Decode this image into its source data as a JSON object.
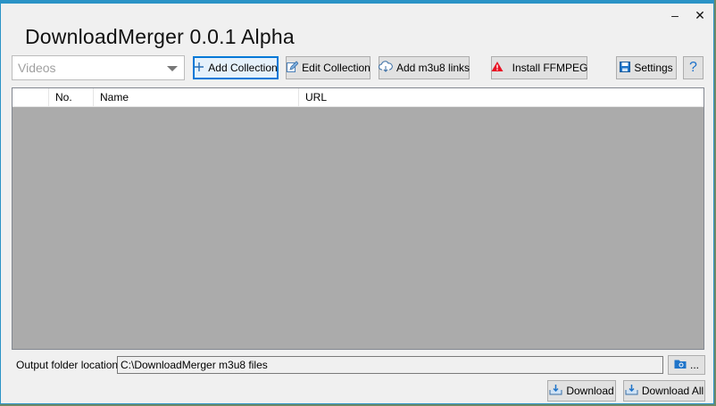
{
  "window": {
    "title": "DownloadMerger 0.0.1 Alpha",
    "minimize_glyph": "–",
    "close_glyph": "✕"
  },
  "toolbar": {
    "collection_select": {
      "value": "Videos"
    },
    "add_collection": "Add Collection",
    "edit_collection": "Edit Collection",
    "add_m3u8": "Add m3u8 links",
    "install_ffmpeg": "Install FFMPEG",
    "settings": "Settings",
    "help": "?"
  },
  "grid": {
    "columns": [
      "",
      "No.",
      "Name",
      "URL"
    ],
    "rows": []
  },
  "output": {
    "label": "Output folder location:",
    "path": "C:\\DownloadMerger m3u8 files",
    "browse_label": "..."
  },
  "actions": {
    "download": "Download",
    "download_all": "Download All"
  },
  "colors": {
    "accent": "#0078d7",
    "window_border": "#2a93c6",
    "grid_background": "#ababab",
    "warning": "#e81123"
  }
}
